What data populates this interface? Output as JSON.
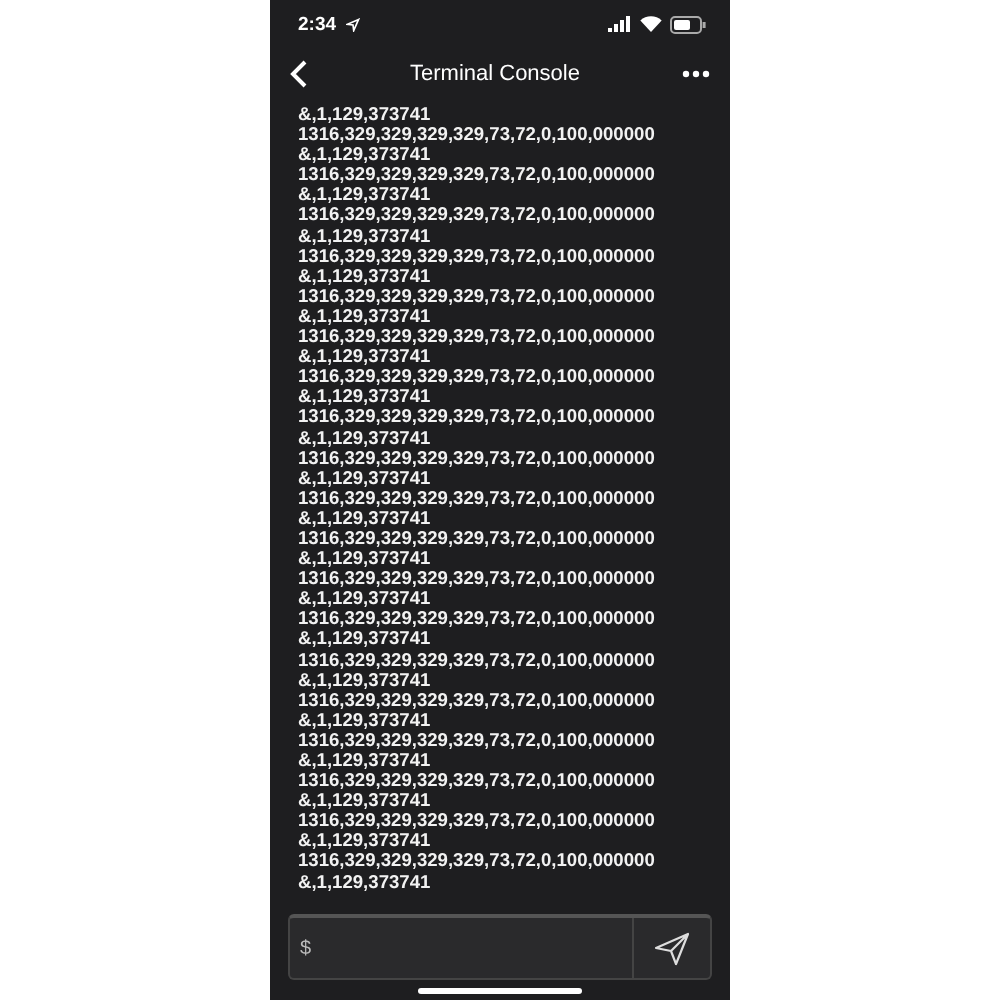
{
  "status_bar": {
    "time": "2:34"
  },
  "nav": {
    "title": "Terminal Console"
  },
  "console_lines": [
    "&,1,129,373741",
    "1316,329,329,329,329,73,72,0,100,000000",
    "&,1,129,373741",
    "1316,329,329,329,329,73,72,0,100,000000",
    "&,1,129,373741",
    "1316,329,329,329,329,73,72,0,100,000000",
    "&,1,129,373741",
    "1316,329,329,329,329,73,72,0,100,000000",
    "&,1,129,373741",
    "1316,329,329,329,329,73,72,0,100,000000",
    "&,1,129,373741",
    "1316,329,329,329,329,73,72,0,100,000000",
    "&,1,129,373741",
    "1316,329,329,329,329,73,72,0,100,000000",
    "&,1,129,373741",
    "1316,329,329,329,329,73,72,0,100,000000",
    "&,1,129,373741",
    "1316,329,329,329,329,73,72,0,100,000000",
    "&,1,129,373741",
    "1316,329,329,329,329,73,72,0,100,000000",
    "&,1,129,373741",
    "1316,329,329,329,329,73,72,0,100,000000",
    "&,1,129,373741",
    "1316,329,329,329,329,73,72,0,100,000000",
    "&,1,129,373741",
    "1316,329,329,329,329,73,72,0,100,000000",
    "&,1,129,373741",
    "1316,329,329,329,329,73,72,0,100,000000",
    "&,1,129,373741",
    "1316,329,329,329,329,73,72,0,100,000000",
    "&,1,129,373741",
    "1316,329,329,329,329,73,72,0,100,000000",
    "&,1,129,373741",
    "1316,329,329,329,329,73,72,0,100,000000",
    "&,1,129,373741",
    "1316,329,329,329,329,73,72,0,100,000000",
    "&,1,129,373741",
    "1316,329,329,329,329,73,72,0,100,000000",
    "&,1,129,373741"
  ],
  "input": {
    "placeholder": "$"
  }
}
